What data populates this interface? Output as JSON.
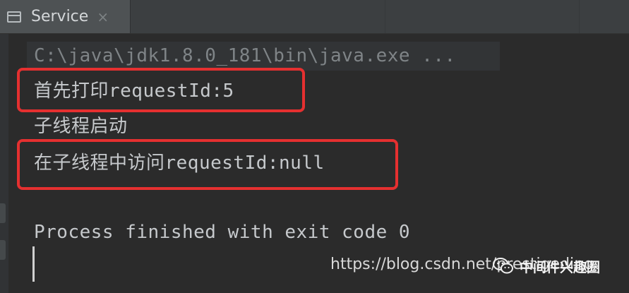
{
  "tab": {
    "label": "Service",
    "close_glyph": "×",
    "icon": "console-window-icon"
  },
  "console": {
    "command_line": "C:\\java\\jdk1.8.0_181\\bin\\java.exe ...",
    "lines": [
      "首先打印requestId:5",
      "子线程启动",
      "在子线程中访问requestId:null",
      "Process finished with exit code 0"
    ]
  },
  "watermark": {
    "url": "https://blog.csdn.net/prestigeding",
    "brand": "中间件兴趣圈",
    "icon": "wechat-icon"
  },
  "colors": {
    "background": "#2b2b2b",
    "text": "#c6c9cc",
    "command_text": "#7f8487",
    "highlight_border": "#e53030"
  }
}
